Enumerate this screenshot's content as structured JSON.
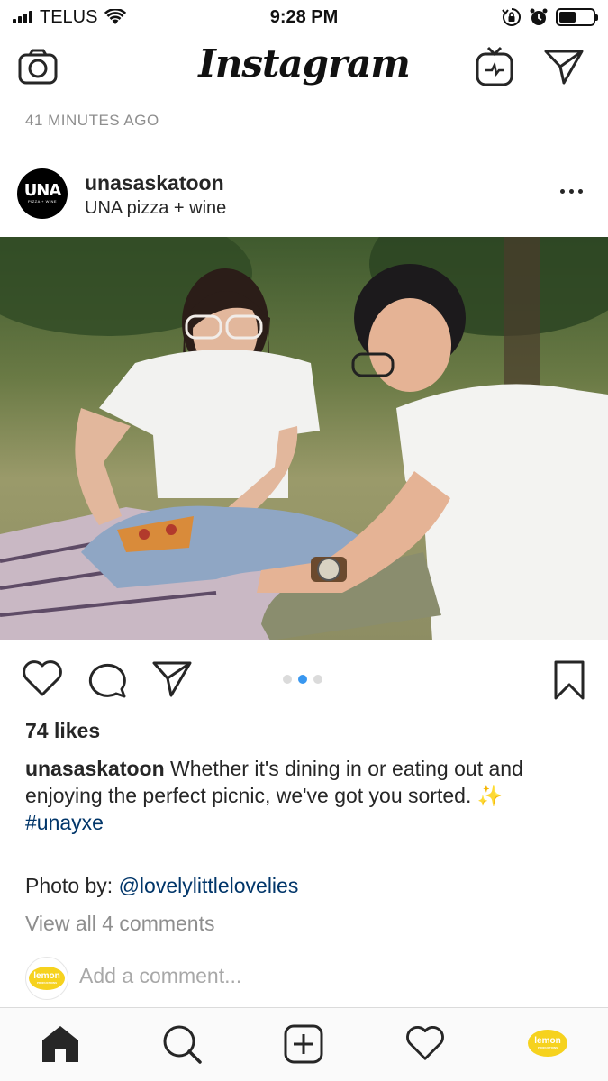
{
  "status_bar": {
    "carrier": "TELUS",
    "time": "9:28 PM",
    "battery_level": 0.5
  },
  "top_nav": {
    "logo": "Instagram"
  },
  "post": {
    "time_ago": "41 MINUTES AGO",
    "username": "unasaskatoon",
    "location": "UNA pizza + wine",
    "avatar_text": "UNA",
    "avatar_subtext": "PIZZA + WINE",
    "carousel_total": 3,
    "carousel_active": 2,
    "likes": "74 likes",
    "caption": {
      "username": "unasaskatoon",
      "text": " Whether it's dining in or eating out and enjoying the perfect picnic, we've got you sorted. ",
      "emoji": "✨",
      "hashtag": "#unayxe"
    },
    "photo_by": {
      "label": "Photo by: ",
      "mention": "@lovelylittlelovelies"
    },
    "view_comments": "View all 4 comments",
    "comment_placeholder": "Add a comment...",
    "commenter_avatar_text": "lemon",
    "commenter_avatar_subtext": "PRODUCTIONS"
  },
  "icons": {
    "camera": "camera-icon",
    "igtv": "igtv-icon",
    "direct": "direct-message-icon",
    "like": "heart-icon",
    "comment": "comment-icon",
    "share": "share-icon",
    "save": "bookmark-icon",
    "home": "home-icon",
    "search": "search-icon",
    "new_post": "add-post-icon",
    "activity": "heart-icon",
    "profile": "profile-avatar"
  },
  "colors": {
    "link": "#003569",
    "muted": "#8e8e8e",
    "carousel_active": "#3897f0"
  }
}
